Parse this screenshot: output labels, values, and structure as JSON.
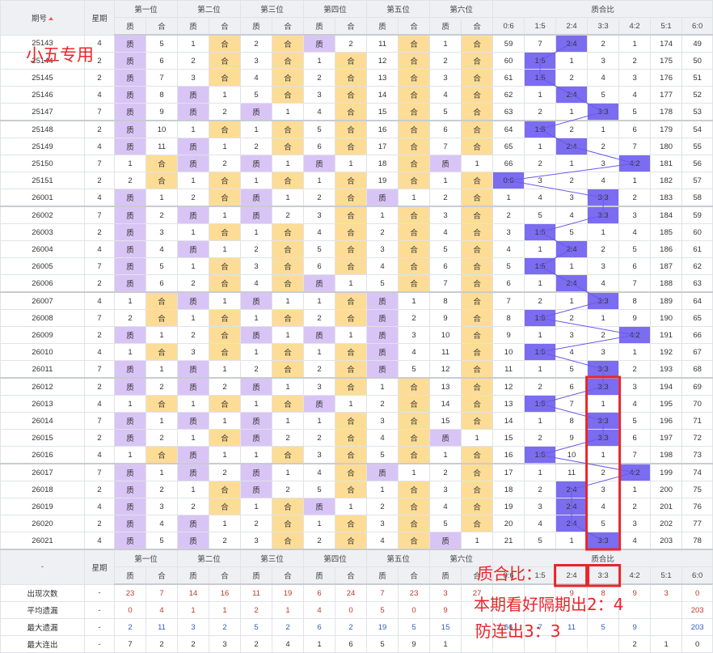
{
  "header": {
    "issue": "期号",
    "week": "星期",
    "positions": [
      "第一位",
      "第二位",
      "第三位",
      "第四位",
      "第五位",
      "第六位"
    ],
    "ratio_group": "质合比",
    "zhi": "质",
    "he": "合",
    "ratios": [
      "0:6",
      "1:5",
      "2:4",
      "3:3",
      "4:2",
      "5:1",
      "6:0"
    ]
  },
  "rows": [
    {
      "id": "25143",
      "wk": "4",
      "p": [
        [
          "Z",
          "5"
        ],
        [
          "1",
          "H"
        ],
        [
          "2",
          "H"
        ],
        [
          "Z",
          "2"
        ],
        [
          "11",
          "H"
        ],
        [
          "1",
          "H"
        ]
      ],
      "r": [
        "59",
        "7",
        "H",
        "2",
        "1",
        "174",
        "49"
      ]
    },
    {
      "id": "25144",
      "wk": "2",
      "p": [
        [
          "Z",
          "6"
        ],
        [
          "2",
          "H"
        ],
        [
          "3",
          "H"
        ],
        [
          "1",
          "H"
        ],
        [
          "12",
          "H"
        ],
        [
          "2",
          "H"
        ]
      ],
      "r": [
        "60",
        "H",
        "1",
        "3",
        "2",
        "175",
        "50"
      ]
    },
    {
      "id": "25145",
      "wk": "2",
      "p": [
        [
          "Z",
          "7"
        ],
        [
          "3",
          "H"
        ],
        [
          "4",
          "H"
        ],
        [
          "2",
          "H"
        ],
        [
          "13",
          "H"
        ],
        [
          "3",
          "H"
        ]
      ],
      "r": [
        "61",
        "H",
        "2",
        "4",
        "3",
        "176",
        "51"
      ]
    },
    {
      "id": "25146",
      "wk": "4",
      "p": [
        [
          "Z",
          "8"
        ],
        [
          "Z",
          "1"
        ],
        [
          "5",
          "H"
        ],
        [
          "3",
          "H"
        ],
        [
          "14",
          "H"
        ],
        [
          "4",
          "H"
        ]
      ],
      "r": [
        "62",
        "1",
        "H",
        "5",
        "4",
        "177",
        "52"
      ]
    },
    {
      "id": "25147",
      "wk": "7",
      "p": [
        [
          "Z",
          "9"
        ],
        [
          "Z",
          "2"
        ],
        [
          "Z",
          "1"
        ],
        [
          "4",
          "H"
        ],
        [
          "15",
          "H"
        ],
        [
          "5",
          "H"
        ]
      ],
      "r": [
        "63",
        "2",
        "1",
        "H",
        "5",
        "178",
        "53"
      ]
    },
    {
      "id": "25148",
      "wk": "2",
      "p": [
        [
          "Z",
          "10"
        ],
        [
          "1",
          "H"
        ],
        [
          "1",
          "H"
        ],
        [
          "5",
          "H"
        ],
        [
          "16",
          "H"
        ],
        [
          "6",
          "H"
        ]
      ],
      "r": [
        "64",
        "H",
        "2",
        "1",
        "6",
        "179",
        "54"
      ]
    },
    {
      "id": "25149",
      "wk": "4",
      "p": [
        [
          "Z",
          "11"
        ],
        [
          "Z",
          "1"
        ],
        [
          "2",
          "H"
        ],
        [
          "6",
          "H"
        ],
        [
          "17",
          "H"
        ],
        [
          "7",
          "H"
        ]
      ],
      "r": [
        "65",
        "1",
        "H",
        "2",
        "7",
        "180",
        "55"
      ]
    },
    {
      "id": "25150",
      "wk": "7",
      "p": [
        [
          "1",
          "H"
        ],
        [
          "Z",
          "2"
        ],
        [
          "Z",
          "1"
        ],
        [
          "Z",
          "1"
        ],
        [
          "18",
          "H"
        ],
        [
          "Z",
          "1"
        ]
      ],
      "r": [
        "66",
        "2",
        "1",
        "3",
        "H",
        "181",
        "56"
      ]
    },
    {
      "id": "25151",
      "wk": "2",
      "p": [
        [
          "2",
          "H"
        ],
        [
          "1",
          "H"
        ],
        [
          "1",
          "H"
        ],
        [
          "1",
          "H"
        ],
        [
          "19",
          "H"
        ],
        [
          "1",
          "H"
        ]
      ],
      "r": [
        "H",
        "3",
        "2",
        "4",
        "1",
        "182",
        "57"
      ]
    },
    {
      "id": "26001",
      "wk": "4",
      "p": [
        [
          "Z",
          "1"
        ],
        [
          "2",
          "H"
        ],
        [
          "Z",
          "1"
        ],
        [
          "2",
          "H"
        ],
        [
          "Z",
          "1"
        ],
        [
          "2",
          "H"
        ]
      ],
      "r": [
        "1",
        "4",
        "3",
        "H",
        "2",
        "183",
        "58"
      ]
    },
    {
      "id": "26002",
      "wk": "7",
      "p": [
        [
          "Z",
          "2"
        ],
        [
          "Z",
          "1"
        ],
        [
          "Z",
          "2"
        ],
        [
          "3",
          "H"
        ],
        [
          "1",
          "H"
        ],
        [
          "3",
          "H"
        ]
      ],
      "r": [
        "2",
        "5",
        "4",
        "H",
        "3",
        "184",
        "59"
      ]
    },
    {
      "id": "26003",
      "wk": "2",
      "p": [
        [
          "Z",
          "3"
        ],
        [
          "1",
          "H"
        ],
        [
          "1",
          "H"
        ],
        [
          "4",
          "H"
        ],
        [
          "2",
          "H"
        ],
        [
          "4",
          "H"
        ]
      ],
      "r": [
        "3",
        "H",
        "5",
        "1",
        "4",
        "185",
        "60"
      ]
    },
    {
      "id": "26004",
      "wk": "4",
      "p": [
        [
          "Z",
          "4"
        ],
        [
          "Z",
          "1"
        ],
        [
          "2",
          "H"
        ],
        [
          "5",
          "H"
        ],
        [
          "3",
          "H"
        ],
        [
          "5",
          "H"
        ]
      ],
      "r": [
        "4",
        "1",
        "H",
        "2",
        "5",
        "186",
        "61"
      ]
    },
    {
      "id": "26005",
      "wk": "7",
      "p": [
        [
          "Z",
          "5"
        ],
        [
          "1",
          "H"
        ],
        [
          "3",
          "H"
        ],
        [
          "6",
          "H"
        ],
        [
          "4",
          "H"
        ],
        [
          "6",
          "H"
        ]
      ],
      "r": [
        "5",
        "H",
        "1",
        "3",
        "6",
        "187",
        "62"
      ]
    },
    {
      "id": "26006",
      "wk": "2",
      "p": [
        [
          "Z",
          "6"
        ],
        [
          "2",
          "H"
        ],
        [
          "4",
          "H"
        ],
        [
          "Z",
          "1"
        ],
        [
          "5",
          "H"
        ],
        [
          "7",
          "H"
        ]
      ],
      "r": [
        "6",
        "1",
        "H",
        "4",
        "7",
        "188",
        "63"
      ]
    },
    {
      "id": "26007",
      "wk": "4",
      "p": [
        [
          "1",
          "H"
        ],
        [
          "Z",
          "1"
        ],
        [
          "Z",
          "1"
        ],
        [
          "1",
          "H"
        ],
        [
          "Z",
          "1"
        ],
        [
          "8",
          "H"
        ]
      ],
      "r": [
        "7",
        "2",
        "1",
        "H",
        "8",
        "189",
        "64"
      ]
    },
    {
      "id": "26008",
      "wk": "7",
      "p": [
        [
          "2",
          "H"
        ],
        [
          "1",
          "H"
        ],
        [
          "1",
          "H"
        ],
        [
          "2",
          "H"
        ],
        [
          "Z",
          "2"
        ],
        [
          "9",
          "H"
        ]
      ],
      "r": [
        "8",
        "H",
        "2",
        "1",
        "9",
        "190",
        "65"
      ]
    },
    {
      "id": "26009",
      "wk": "2",
      "p": [
        [
          "Z",
          "1"
        ],
        [
          "2",
          "H"
        ],
        [
          "Z",
          "1"
        ],
        [
          "Z",
          "1"
        ],
        [
          "Z",
          "3"
        ],
        [
          "10",
          "H"
        ]
      ],
      "r": [
        "9",
        "1",
        "3",
        "2",
        "H",
        "191",
        "66"
      ]
    },
    {
      "id": "26010",
      "wk": "4",
      "p": [
        [
          "1",
          "H"
        ],
        [
          "3",
          "H"
        ],
        [
          "1",
          "H"
        ],
        [
          "1",
          "H"
        ],
        [
          "Z",
          "4"
        ],
        [
          "11",
          "H"
        ]
      ],
      "r": [
        "10",
        "H",
        "4",
        "3",
        "1",
        "192",
        "67"
      ]
    },
    {
      "id": "26011",
      "wk": "7",
      "p": [
        [
          "Z",
          "1"
        ],
        [
          "Z",
          "1"
        ],
        [
          "2",
          "H"
        ],
        [
          "2",
          "H"
        ],
        [
          "Z",
          "5"
        ],
        [
          "12",
          "H"
        ]
      ],
      "r": [
        "11",
        "1",
        "5",
        "H",
        "2",
        "193",
        "68"
      ]
    },
    {
      "id": "26012",
      "wk": "2",
      "p": [
        [
          "Z",
          "2"
        ],
        [
          "Z",
          "2"
        ],
        [
          "Z",
          "1"
        ],
        [
          "3",
          "H"
        ],
        [
          "1",
          "H"
        ],
        [
          "13",
          "H"
        ]
      ],
      "r": [
        "12",
        "2",
        "6",
        "H",
        "3",
        "194",
        "69"
      ]
    },
    {
      "id": "26013",
      "wk": "4",
      "p": [
        [
          "1",
          "H"
        ],
        [
          "1",
          "H"
        ],
        [
          "1",
          "H"
        ],
        [
          "Z",
          "1"
        ],
        [
          "2",
          "H"
        ],
        [
          "14",
          "H"
        ]
      ],
      "r": [
        "13",
        "H",
        "7",
        "1",
        "4",
        "195",
        "70"
      ]
    },
    {
      "id": "26014",
      "wk": "7",
      "p": [
        [
          "Z",
          "1"
        ],
        [
          "Z",
          "1"
        ],
        [
          "Z",
          "1"
        ],
        [
          "1",
          "H"
        ],
        [
          "3",
          "H"
        ],
        [
          "15",
          "H"
        ]
      ],
      "r": [
        "14",
        "1",
        "8",
        "H",
        "5",
        "196",
        "71"
      ]
    },
    {
      "id": "26015",
      "wk": "2",
      "p": [
        [
          "Z",
          "2"
        ],
        [
          "1",
          "H"
        ],
        [
          "Z",
          "2"
        ],
        [
          "2",
          "H"
        ],
        [
          "4",
          "H"
        ],
        [
          "Z",
          "1"
        ]
      ],
      "r": [
        "15",
        "2",
        "9",
        "H",
        "6",
        "197",
        "72"
      ]
    },
    {
      "id": "26016",
      "wk": "4",
      "p": [
        [
          "1",
          "H"
        ],
        [
          "Z",
          "1"
        ],
        [
          "1",
          "H"
        ],
        [
          "3",
          "H"
        ],
        [
          "5",
          "H"
        ],
        [
          "1",
          "H"
        ]
      ],
      "r": [
        "16",
        "H",
        "10",
        "1",
        "7",
        "198",
        "73"
      ]
    },
    {
      "id": "26017",
      "wk": "7",
      "p": [
        [
          "Z",
          "1"
        ],
        [
          "Z",
          "2"
        ],
        [
          "Z",
          "1"
        ],
        [
          "4",
          "H"
        ],
        [
          "Z",
          "1"
        ],
        [
          "2",
          "H"
        ]
      ],
      "r": [
        "17",
        "1",
        "11",
        "2",
        "H",
        "199",
        "74"
      ]
    },
    {
      "id": "26018",
      "wk": "2",
      "p": [
        [
          "Z",
          "2"
        ],
        [
          "1",
          "H"
        ],
        [
          "Z",
          "2"
        ],
        [
          "5",
          "H"
        ],
        [
          "1",
          "H"
        ],
        [
          "3",
          "H"
        ]
      ],
      "r": [
        "18",
        "2",
        "H",
        "3",
        "1",
        "200",
        "75"
      ]
    },
    {
      "id": "26019",
      "wk": "4",
      "p": [
        [
          "Z",
          "3"
        ],
        [
          "2",
          "H"
        ],
        [
          "1",
          "H"
        ],
        [
          "Z",
          "1"
        ],
        [
          "2",
          "H"
        ],
        [
          "4",
          "H"
        ]
      ],
      "r": [
        "19",
        "3",
        "H",
        "4",
        "2",
        "201",
        "76"
      ]
    },
    {
      "id": "26020",
      "wk": "2",
      "p": [
        [
          "Z",
          "4"
        ],
        [
          "Z",
          "1"
        ],
        [
          "2",
          "H"
        ],
        [
          "1",
          "H"
        ],
        [
          "3",
          "H"
        ],
        [
          "5",
          "H"
        ]
      ],
      "r": [
        "20",
        "4",
        "H",
        "5",
        "3",
        "202",
        "77"
      ]
    },
    {
      "id": "26021",
      "wk": "4",
      "p": [
        [
          "Z",
          "5"
        ],
        [
          "Z",
          "2"
        ],
        [
          "3",
          "H"
        ],
        [
          "2",
          "H"
        ],
        [
          "4",
          "H"
        ],
        [
          "Z",
          "1"
        ]
      ],
      "r": [
        "21",
        "5",
        "1",
        "H",
        "4",
        "203",
        "78"
      ]
    }
  ],
  "footer_header": {
    "issue": "-",
    "week": "星期"
  },
  "summary": [
    {
      "label": "出现次数",
      "wk": "-",
      "vals": [
        "23",
        "7",
        "14",
        "16",
        "11",
        "19",
        "6",
        "24",
        "7",
        "23",
        "3",
        "27",
        "",
        "",
        "9",
        "8",
        "9",
        "3",
        "0",
        "0"
      ]
    },
    {
      "label": "平均遗漏",
      "wk": "-",
      "vals": [
        "0",
        "4",
        "1",
        "1",
        "2",
        "1",
        "4",
        "0",
        "5",
        "0",
        "9",
        "",
        "",
        "",
        "",
        "",
        "",
        "",
        "203",
        "78"
      ]
    },
    {
      "label": "最大遗漏",
      "wk": "-",
      "vals": [
        "2",
        "11",
        "3",
        "2",
        "5",
        "2",
        "6",
        "2",
        "19",
        "5",
        "15",
        "1",
        "66",
        "7",
        "11",
        "5",
        "9",
        "",
        "203",
        "78"
      ]
    },
    {
      "label": "最大连出",
      "wk": "-",
      "vals": [
        "7",
        "2",
        "2",
        "3",
        "2",
        "4",
        "1",
        "6",
        "5",
        "9",
        "1",
        "",
        "",
        "",
        "",
        "",
        "2",
        "1",
        "0",
        "0"
      ]
    }
  ],
  "annotations": {
    "tag": "小五专用",
    "line1": "质合比：",
    "line2": "本期看好隔期出2：4",
    "line3": "防连出3：3"
  },
  "colors": {
    "zhi": "#d9c5f5",
    "he": "#fddc95",
    "hit": "#7b6cf0",
    "note": "#e8262a"
  },
  "icons": {
    "sort": "sort-up-icon"
  }
}
